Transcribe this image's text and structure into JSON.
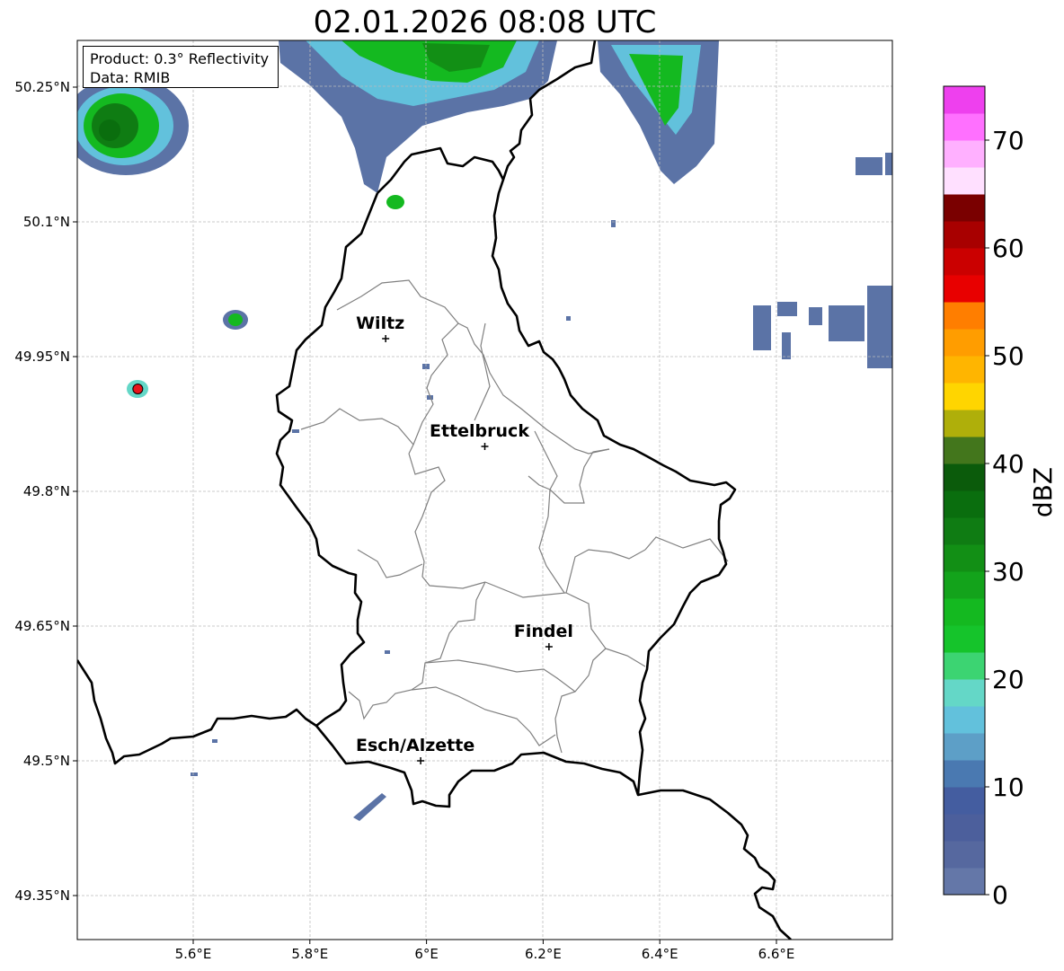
{
  "title": "02.01.2026 08:08 UTC",
  "info": {
    "product": "Product: 0.3° Reflectivity",
    "data": "Data: RMIB"
  },
  "axes": {
    "lon_ticks": [
      "5.6°E",
      "5.8°E",
      "6°E",
      "6.2°E",
      "6.4°E",
      "6.6°E"
    ],
    "lat_ticks": [
      "50.25°N",
      "50.1°N",
      "49.95°N",
      "49.8°N",
      "49.65°N",
      "49.5°N",
      "49.35°N"
    ]
  },
  "cities": [
    {
      "name": "Wiltz",
      "lon": 5.93,
      "lat": 49.97
    },
    {
      "name": "Ettelbruck",
      "lon": 6.1,
      "lat": 49.85
    },
    {
      "name": "Findel",
      "lon": 6.21,
      "lat": 49.627
    },
    {
      "name": "Esch/Alzette",
      "lon": 5.99,
      "lat": 49.5
    }
  ],
  "radar_site": {
    "lon": 5.505,
    "lat": 49.914,
    "color": "#e8141b"
  },
  "colorbar": {
    "label": "dBZ",
    "ticks": [
      "0",
      "10",
      "20",
      "30",
      "40",
      "50",
      "60",
      "70"
    ],
    "step_dbz": 2.5,
    "colors": [
      "#6477a8",
      "#56689f",
      "#4c5f9c",
      "#445da0",
      "#4a79b1",
      "#5d9fc7",
      "#62c1dc",
      "#64d7c7",
      "#3cd472",
      "#15c42b",
      "#14b920",
      "#13a31b",
      "#128f15",
      "#0f7c13",
      "#0a6e0e",
      "#0b5b0b",
      "#43761c",
      "#afaf0a",
      "#ffd500",
      "#ffb500",
      "#ff9d00",
      "#ff7e00",
      "#e80000",
      "#cb0000",
      "#a80000",
      "#7a0000",
      "#ffe0ff",
      "#ffb0ff",
      "#ff70ff",
      "#ee40ee"
    ]
  },
  "colors": {
    "border": "#000000",
    "districts": "#808080",
    "grid": "#bbbbbb"
  }
}
